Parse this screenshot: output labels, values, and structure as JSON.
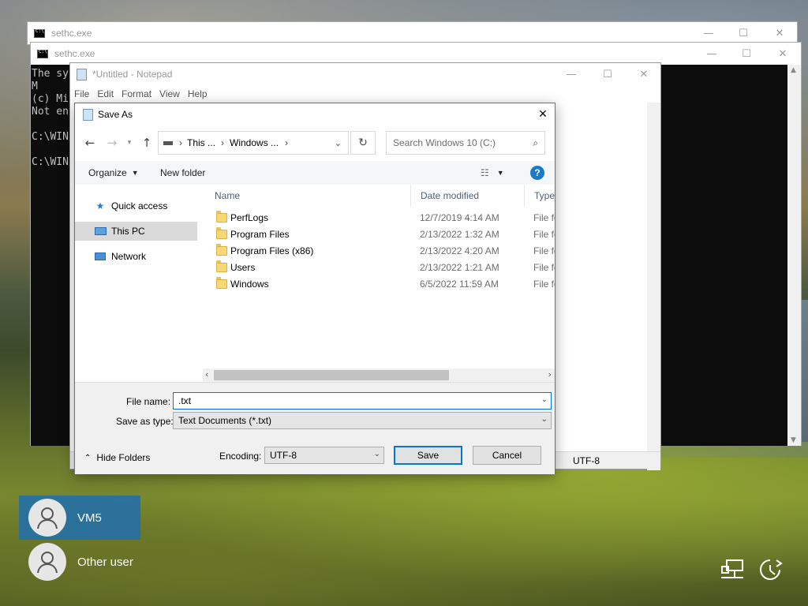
{
  "background": {
    "accent": "#1e6fae"
  },
  "cmd_back": {
    "title": "sethc.exe"
  },
  "cmd_front": {
    "title": "sethc.exe",
    "lines": [
      "The sy",
      "M",
      "(c) Mi",
      "Not en",
      "",
      "C:\\WIN",
      "",
      "C:\\WIN"
    ]
  },
  "window_controls": {
    "minimize": "—",
    "maximize": "☐",
    "close": "✕"
  },
  "notepad": {
    "title": "*Untitled - Notepad",
    "menu": [
      "File",
      "Edit",
      "Format",
      "View",
      "Help"
    ],
    "status_encoding": "UTF-8"
  },
  "save_dialog": {
    "title": "Save As",
    "breadcrumb": [
      "This ...",
      "Windows ..."
    ],
    "search_placeholder": "Search Windows 10 (C:)",
    "organize_label": "Organize",
    "new_folder_label": "New folder",
    "help_label": "?",
    "nav": [
      {
        "label": "Quick access",
        "icon": "star-icon"
      },
      {
        "label": "This PC",
        "icon": "computer-icon"
      },
      {
        "label": "Network",
        "icon": "network-icon"
      }
    ],
    "columns": [
      "Name",
      "Date modified",
      "Type"
    ],
    "files": [
      {
        "name": "PerfLogs",
        "date": "12/7/2019 4:14 AM",
        "type": "File fo"
      },
      {
        "name": "Program Files",
        "date": "2/13/2022 1:32 AM",
        "type": "File fo"
      },
      {
        "name": "Program Files (x86)",
        "date": "2/13/2022 4:20 AM",
        "type": "File fo"
      },
      {
        "name": "Users",
        "date": "2/13/2022 1:21 AM",
        "type": "File fo"
      },
      {
        "name": "Windows",
        "date": "6/5/2022 11:59 AM",
        "type": "File fo"
      }
    ],
    "file_name_label": "File name:",
    "file_name_value": ".txt",
    "save_type_label": "Save as type:",
    "save_type_value": "Text Documents (*.txt)",
    "hide_folders_label": "Hide Folders",
    "encoding_label": "Encoding:",
    "encoding_value": "UTF-8",
    "save_button": "Save",
    "cancel_button": "Cancel"
  },
  "login": {
    "users": [
      {
        "name": "VM5",
        "selected": true
      },
      {
        "name": "Other user",
        "selected": false
      }
    ]
  }
}
